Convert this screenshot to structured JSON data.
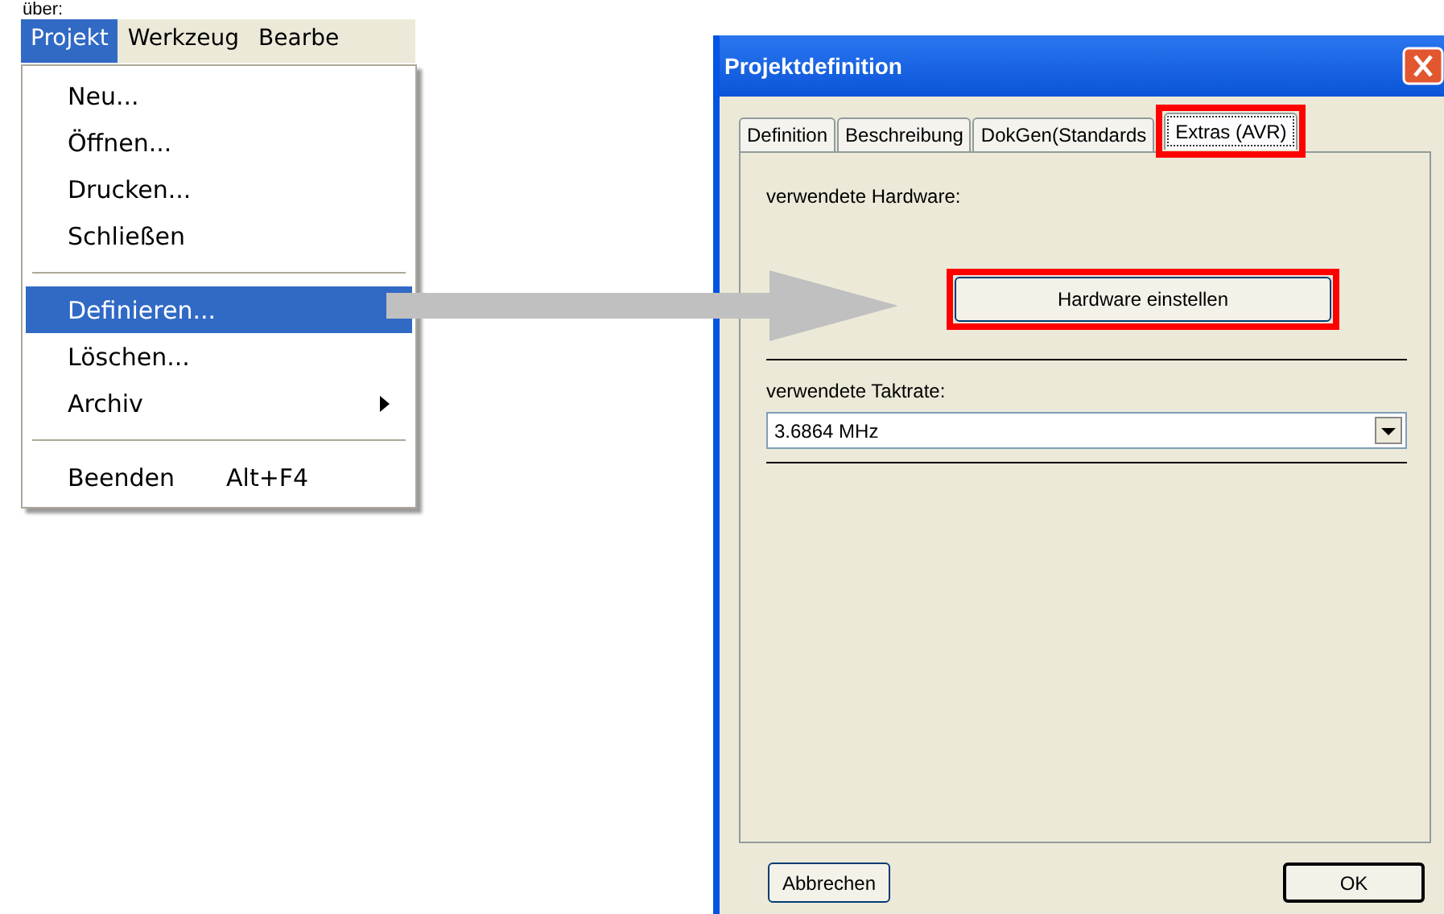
{
  "caption": "über:",
  "menu_bar": [
    {
      "label": "Projekt",
      "selected": true
    },
    {
      "label": "Werkzeug",
      "selected": false
    },
    {
      "label": "Bearbe",
      "selected": false
    }
  ],
  "menu": [
    {
      "kind": "item",
      "label": "Neu...",
      "selected": false
    },
    {
      "kind": "item",
      "label": "Öffnen...",
      "selected": false
    },
    {
      "kind": "item",
      "label": "Drucken...",
      "selected": false
    },
    {
      "kind": "item",
      "label": "Schließen",
      "selected": false
    },
    {
      "kind": "separator"
    },
    {
      "kind": "item",
      "label": "Definieren...",
      "selected": true
    },
    {
      "kind": "item",
      "label": "Löschen...",
      "selected": false
    },
    {
      "kind": "item",
      "label": "Archiv",
      "selected": false,
      "submenu": true
    },
    {
      "kind": "separator"
    },
    {
      "kind": "item",
      "label": "Beenden",
      "selected": false,
      "shortcut": "Alt+F4"
    }
  ],
  "dialog": {
    "title": "Projektdefinition",
    "tabs": [
      {
        "label": "Definition",
        "selected": false,
        "highlighted": false
      },
      {
        "label": "Beschreibung",
        "selected": false,
        "highlighted": false
      },
      {
        "label": "DokGen(Standards",
        "selected": false,
        "highlighted": false
      },
      {
        "label": "Extras (AVR)",
        "selected": true,
        "highlighted": true
      }
    ],
    "hardware_label": "verwendete Hardware:",
    "hardware_button": {
      "label": "Hardware einstellen",
      "highlighted": true
    },
    "clock_label": "verwendete Taktrate:",
    "clock_select": {
      "value": "3.6864 MHz"
    },
    "buttons": [
      {
        "label": "Abbrechen",
        "default": false
      },
      {
        "label": "OK",
        "default": true
      }
    ]
  }
}
